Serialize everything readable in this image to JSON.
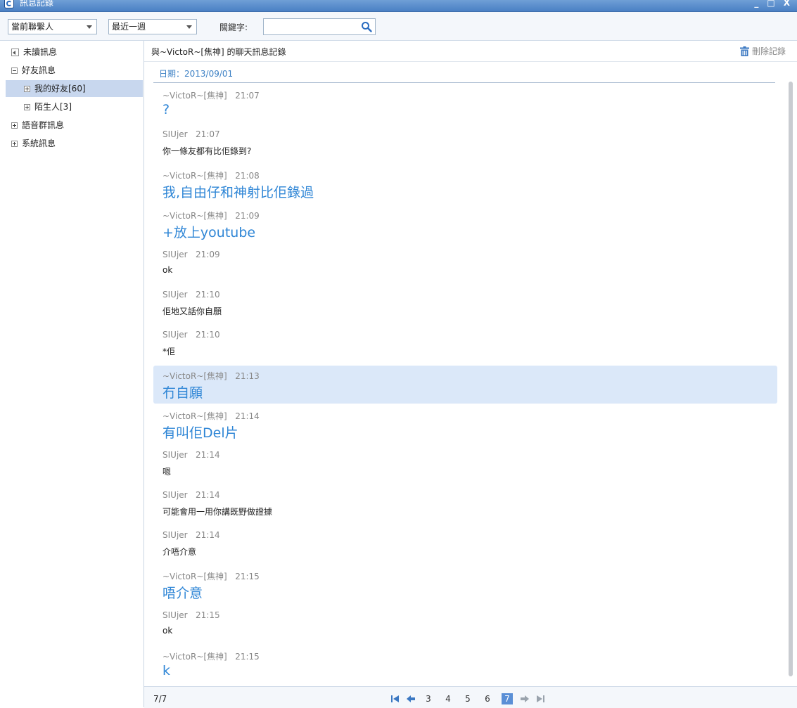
{
  "window": {
    "title": "訊息記錄",
    "controls": [
      "_",
      "□",
      "X"
    ]
  },
  "toolbar": {
    "contact_filter": "當前聯繫人",
    "time_filter": "最近一週",
    "keyword_label": "關鍵字:",
    "keyword_value": "",
    "search_icon": "search-icon"
  },
  "sidebar": {
    "items": [
      {
        "label": "未讀訊息",
        "icon": "speaker-icon",
        "level": 0
      },
      {
        "label": "好友訊息",
        "icon": "collapse-icon",
        "level": 0
      },
      {
        "label": "我的好友[60]",
        "icon": "expand-icon",
        "level": 1,
        "selected": true
      },
      {
        "label": "陌生人[3]",
        "icon": "expand-icon",
        "level": 1
      },
      {
        "label": "語音群訊息",
        "icon": "expand-icon",
        "level": 0
      },
      {
        "label": "系統訊息",
        "icon": "expand-icon",
        "level": 0
      }
    ]
  },
  "conversation": {
    "title": "與~VictoR~[焦神] 的聊天訊息記錄",
    "delete_label": "刪除記錄",
    "date": "日期：2013/09/01",
    "messages": [
      {
        "sender": "~VictoR~[焦神]",
        "time": "21:07",
        "text": "?",
        "style": "big"
      },
      {
        "sender": "SIUjer",
        "time": "21:07",
        "text": "你一條友都有比佢錄到?",
        "style": "small"
      },
      {
        "sender": "~VictoR~[焦神]",
        "time": "21:08",
        "text": "我,自由仔和神射比佢錄過",
        "style": "big"
      },
      {
        "sender": "~VictoR~[焦神]",
        "time": "21:09",
        "text": "+放上youtube",
        "style": "big"
      },
      {
        "sender": "SIUjer",
        "time": "21:09",
        "text": "ok",
        "style": "small"
      },
      {
        "sender": "SIUjer",
        "time": "21:10",
        "text": "佢地又話你自願",
        "style": "small"
      },
      {
        "sender": "SIUjer",
        "time": "21:10",
        "text": "*佢",
        "style": "small"
      },
      {
        "sender": "~VictoR~[焦神]",
        "time": "21:13",
        "text": "冇自願",
        "style": "big",
        "highlight": true
      },
      {
        "sender": "~VictoR~[焦神]",
        "time": "21:14",
        "text": "有叫佢Del片",
        "style": "big"
      },
      {
        "sender": "SIUjer",
        "time": "21:14",
        "text": "嗯",
        "style": "small"
      },
      {
        "sender": "SIUjer",
        "time": "21:14",
        "text": "可能會用一用你講既野做證據",
        "style": "small"
      },
      {
        "sender": "SIUjer",
        "time": "21:14",
        "text": "介唔介意",
        "style": "small"
      },
      {
        "sender": "~VictoR~[焦神]",
        "time": "21:15",
        "text": "唔介意",
        "style": "big"
      },
      {
        "sender": "SIUjer",
        "time": "21:15",
        "text": "ok",
        "style": "small"
      },
      {
        "sender": "~VictoR~[焦神]",
        "time": "21:15",
        "text": "k",
        "style": "big"
      }
    ]
  },
  "pagination": {
    "count": "7/7",
    "pages": [
      "3",
      "4",
      "5",
      "6",
      "7"
    ],
    "current_page": "7"
  },
  "colors": {
    "accent": "#2f86d6",
    "highlight": "#dbe8f9",
    "selected": "#c8d7ee"
  }
}
